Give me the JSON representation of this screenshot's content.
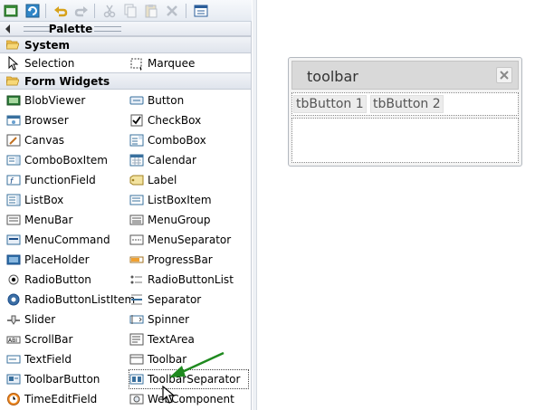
{
  "toolbar": {
    "buttons": [
      "open-icon",
      "refresh-icon",
      "undo-icon",
      "redo-icon",
      "cut-icon",
      "copy-icon",
      "paste-icon",
      "delete-icon",
      "properties-icon"
    ]
  },
  "palette": {
    "title": "Palette",
    "drawers": [
      {
        "label": "System"
      },
      {
        "label": "Form Widgets"
      }
    ],
    "system_items": [
      {
        "label": "Selection",
        "icon": "selection-arrow-icon"
      },
      {
        "label": "Marquee",
        "icon": "marquee-icon"
      }
    ],
    "widgets_left": [
      {
        "label": "BlobViewer",
        "icon": "blobviewer-icon"
      },
      {
        "label": "Browser",
        "icon": "browser-icon"
      },
      {
        "label": "Canvas",
        "icon": "canvas-icon"
      },
      {
        "label": "ComboBoxItem",
        "icon": "comboboxitem-icon"
      },
      {
        "label": "FunctionField",
        "icon": "functionfield-icon"
      },
      {
        "label": "ListBox",
        "icon": "listbox-icon"
      },
      {
        "label": "MenuBar",
        "icon": "menubar-icon"
      },
      {
        "label": "MenuCommand",
        "icon": "menucommand-icon"
      },
      {
        "label": "PlaceHolder",
        "icon": "placeholder-icon"
      },
      {
        "label": "RadioButton",
        "icon": "radiobutton-icon"
      },
      {
        "label": "RadioButtonListItem",
        "icon": "radiobuttonlistitem-icon"
      },
      {
        "label": "Slider",
        "icon": "slider-icon"
      },
      {
        "label": "ScrollBar",
        "icon": "scrollbar-icon"
      },
      {
        "label": "TextField",
        "icon": "textfield-icon"
      },
      {
        "label": "ToolbarButton",
        "icon": "toolbarbutton-icon"
      },
      {
        "label": "TimeEditField",
        "icon": "timeeditfield-icon"
      }
    ],
    "widgets_right": [
      {
        "label": "Button",
        "icon": "button-icon"
      },
      {
        "label": "CheckBox",
        "icon": "checkbox-icon"
      },
      {
        "label": "ComboBox",
        "icon": "combobox-icon"
      },
      {
        "label": "Calendar",
        "icon": "calendar-icon"
      },
      {
        "label": "Label",
        "icon": "label-icon"
      },
      {
        "label": "ListBoxItem",
        "icon": "listboxitem-icon"
      },
      {
        "label": "MenuGroup",
        "icon": "menugroup-icon"
      },
      {
        "label": "MenuSeparator",
        "icon": "menuseparator-icon"
      },
      {
        "label": "ProgressBar",
        "icon": "progressbar-icon"
      },
      {
        "label": "RadioButtonList",
        "icon": "radiobuttonlist-icon"
      },
      {
        "label": "Separator",
        "icon": "separator-icon"
      },
      {
        "label": "Spinner",
        "icon": "spinner-icon"
      },
      {
        "label": "TextArea",
        "icon": "textarea-icon"
      },
      {
        "label": "Toolbar",
        "icon": "toolbar-icon"
      },
      {
        "label": "ToolbarSeparator",
        "icon": "toolbarseparator-icon"
      },
      {
        "label": "WebComponent",
        "icon": "webcomponent-icon"
      }
    ]
  },
  "canvas": {
    "widget": {
      "title": "toolbar",
      "buttons": [
        "tbButton 1",
        "tbButton 2"
      ]
    }
  },
  "colors": {
    "annotation_arrow": "#1f8a1f",
    "folder": "#f0c050"
  }
}
